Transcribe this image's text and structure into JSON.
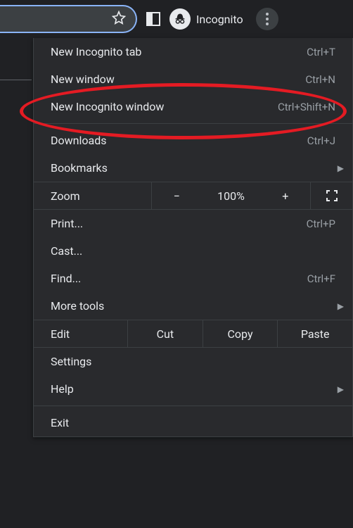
{
  "topbar": {
    "incognito_label": "Incognito"
  },
  "menu": {
    "new_incognito_tab": {
      "label": "New Incognito tab",
      "shortcut": "Ctrl+T"
    },
    "new_window": {
      "label": "New window",
      "shortcut": "Ctrl+N"
    },
    "new_incognito_window": {
      "label": "New Incognito window",
      "shortcut": "Ctrl+Shift+N"
    },
    "downloads": {
      "label": "Downloads",
      "shortcut": "Ctrl+J"
    },
    "bookmarks": {
      "label": "Bookmarks"
    },
    "zoom": {
      "label": "Zoom",
      "minus": "−",
      "value": "100%",
      "plus": "+"
    },
    "print": {
      "label": "Print...",
      "shortcut": "Ctrl+P"
    },
    "cast": {
      "label": "Cast..."
    },
    "find": {
      "label": "Find...",
      "shortcut": "Ctrl+F"
    },
    "more_tools": {
      "label": "More tools"
    },
    "edit": {
      "label": "Edit",
      "cut": "Cut",
      "copy": "Copy",
      "paste": "Paste"
    },
    "settings": {
      "label": "Settings"
    },
    "help": {
      "label": "Help"
    },
    "exit": {
      "label": "Exit"
    }
  },
  "annotation": {
    "target": "new_incognito_window"
  }
}
